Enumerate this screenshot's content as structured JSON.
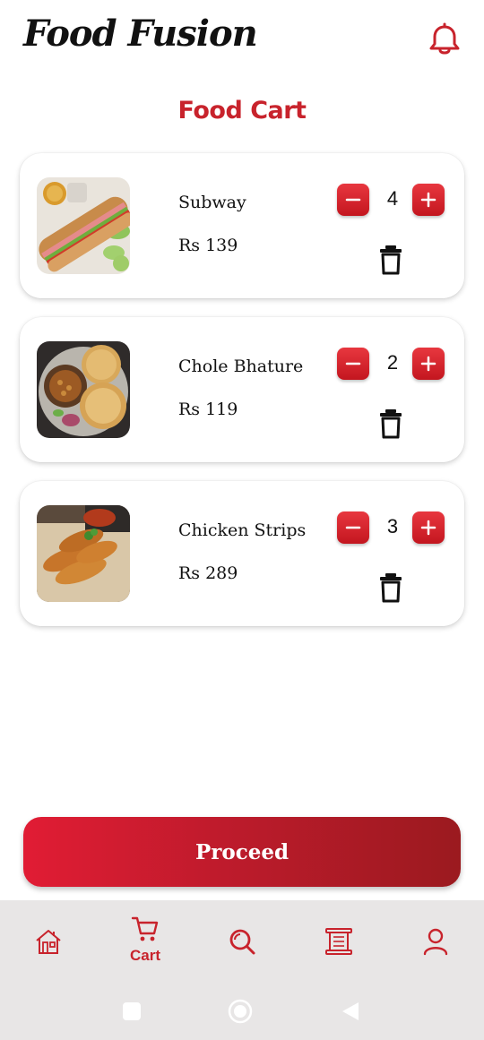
{
  "app": {
    "title": "Food Fusion",
    "notification_icon": "bell-icon"
  },
  "page": {
    "title": "Food Cart"
  },
  "cart": {
    "items": [
      {
        "name": "Subway",
        "price": "Rs 139",
        "quantity": "4",
        "image": "subway-sandwich"
      },
      {
        "name": "Chole Bhature",
        "price": "Rs 119",
        "quantity": "2",
        "image": "chole-bhature"
      },
      {
        "name": "Chicken Strips",
        "price": "Rs 289",
        "quantity": "3",
        "image": "chicken-strips"
      }
    ]
  },
  "proceed": {
    "label": "Proceed"
  },
  "nav": {
    "items": [
      {
        "icon": "home-icon",
        "label": ""
      },
      {
        "icon": "cart-icon",
        "label": "Cart",
        "active": true
      },
      {
        "icon": "search-icon",
        "label": ""
      },
      {
        "icon": "scroll-icon",
        "label": ""
      },
      {
        "icon": "profile-icon",
        "label": ""
      }
    ]
  },
  "system_nav": {
    "icons": [
      "recents-icon",
      "home-circle-icon",
      "back-icon"
    ]
  },
  "colors": {
    "accent": "#c8232c",
    "button_start": "#e11c34",
    "button_end": "#9b1a1f",
    "navbar_bg": "#e8e6e6"
  }
}
